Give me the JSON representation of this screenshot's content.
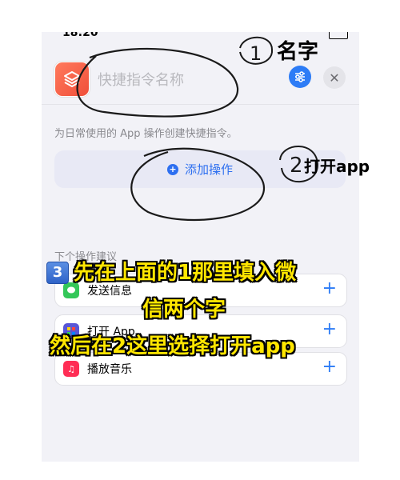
{
  "status": {
    "time": "18:20"
  },
  "header": {
    "title_placeholder": "快捷指令名称"
  },
  "description": "为日常使用的 App 操作创建快捷指令。",
  "add_action": {
    "label": "添加操作"
  },
  "suggestions": {
    "header": "下个操作建议",
    "items": [
      {
        "label": "发送信息",
        "icon": "messages-icon",
        "color": "#34c759"
      },
      {
        "label": "打开 App",
        "icon": "app-grid-icon",
        "color": "#5856d6"
      },
      {
        "label": "播放音乐",
        "icon": "music-icon",
        "color": "#ff2d55"
      }
    ],
    "add_symbol": "+"
  },
  "annotations": {
    "label_1": "名字",
    "label_2": "打开app",
    "num_1": "1",
    "num_2": "2"
  },
  "overlay": {
    "badge": "3",
    "line1": "先在上面的1那里填入微",
    "line2": "信两个字",
    "line3": "然后在2这里选择打开app"
  },
  "colors": {
    "accent": "#2d7cf6",
    "overlay_text": "#ffe600"
  }
}
